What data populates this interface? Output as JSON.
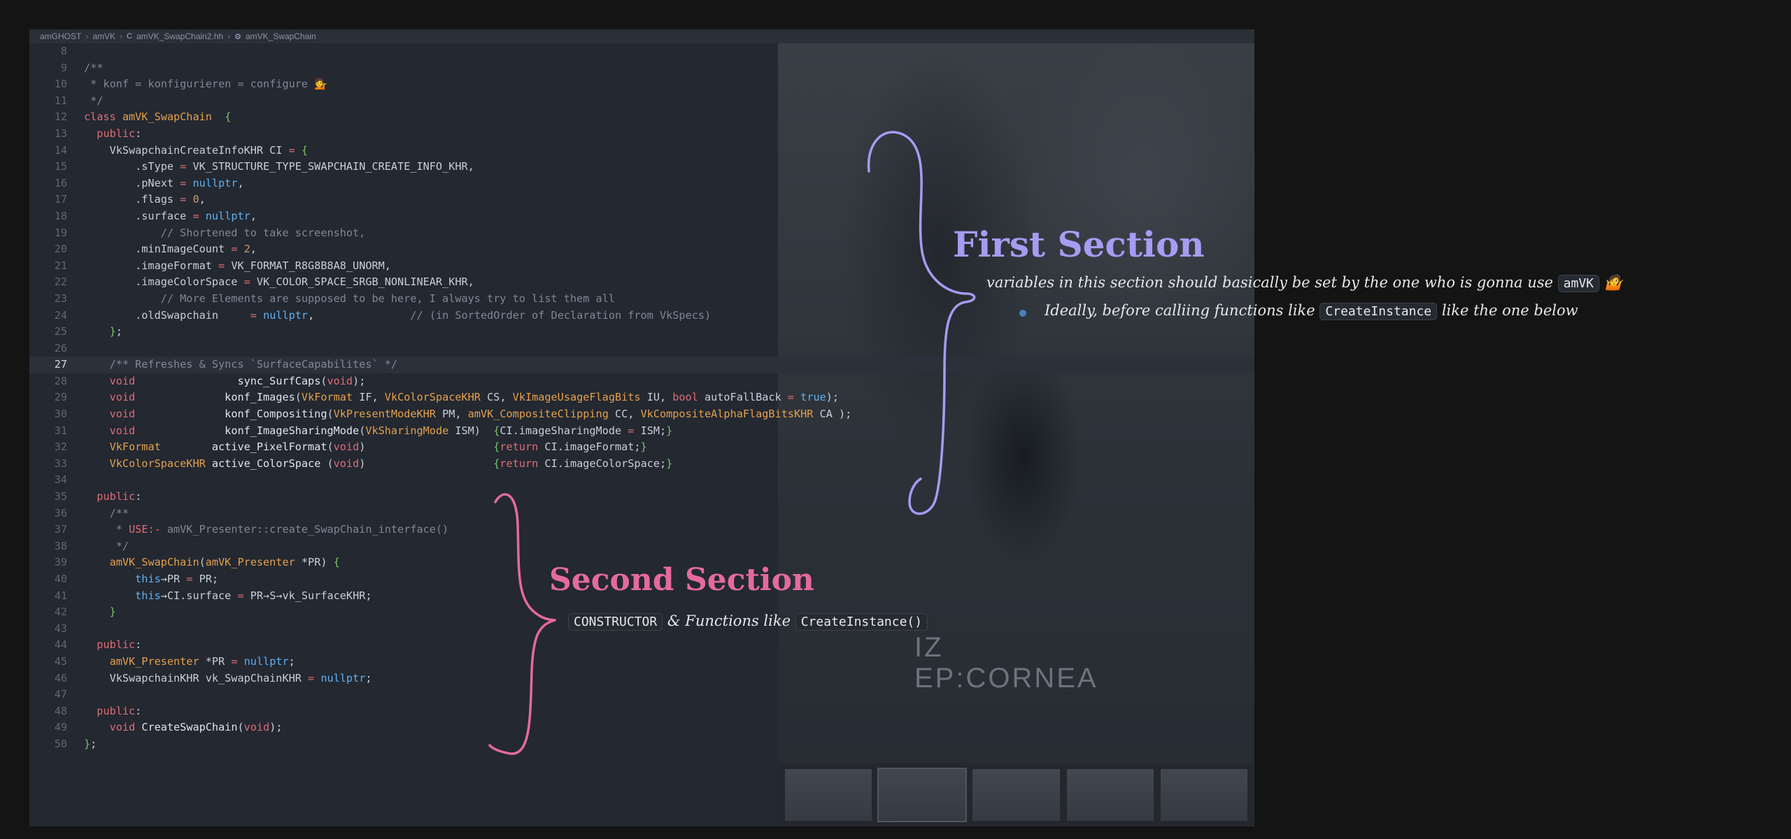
{
  "breadcrumb": {
    "items": [
      "amGHOST",
      "amVK",
      "amVK_SwapChain2.hh",
      "amVK_SwapChain"
    ]
  },
  "editor": {
    "current_line": "27",
    "lines": [
      {
        "n": "8",
        "t": ""
      },
      {
        "n": "9",
        "t": "/**"
      },
      {
        "n": "10",
        "t": " * konf = konfigurieren = configure 💁"
      },
      {
        "n": "11",
        "t": " */"
      },
      {
        "n": "12",
        "t": "class amVK_SwapChain  {"
      },
      {
        "n": "13",
        "t": "  public:"
      },
      {
        "n": "14",
        "t": "    VkSwapchainCreateInfoKHR CI = {"
      },
      {
        "n": "15",
        "t": "        .sType = VK_STRUCTURE_TYPE_SWAPCHAIN_CREATE_INFO_KHR,"
      },
      {
        "n": "16",
        "t": "        .pNext = nullptr,"
      },
      {
        "n": "17",
        "t": "        .flags = 0,"
      },
      {
        "n": "18",
        "t": "        .surface = nullptr,"
      },
      {
        "n": "19",
        "t": "            // Shortened to take screenshot,"
      },
      {
        "n": "20",
        "t": "        .minImageCount = 2,"
      },
      {
        "n": "21",
        "t": "        .imageFormat = VK_FORMAT_R8G8B8A8_UNORM,"
      },
      {
        "n": "22",
        "t": "        .imageColorSpace = VK_COLOR_SPACE_SRGB_NONLINEAR_KHR,"
      },
      {
        "n": "23",
        "t": "            // More Elements are supposed to be here, I always try to list them all"
      },
      {
        "n": "24",
        "t": "        .oldSwapchain     = nullptr,               // (in SortedOrder of Declaration from VkSpecs)"
      },
      {
        "n": "25",
        "t": "    };"
      },
      {
        "n": "26",
        "t": ""
      },
      {
        "n": "27",
        "t": "    /** Refreshes & Syncs `SurfaceCapabilites` */"
      },
      {
        "n": "28",
        "t": "    void                sync_SurfCaps(void);"
      },
      {
        "n": "29",
        "t": "    void              konf_Images(VkFormat IF, VkColorSpaceKHR CS, VkImageUsageFlagBits IU, bool autoFallBack = true);"
      },
      {
        "n": "30",
        "t": "    void              konf_Compositing(VkPresentModeKHR PM, amVK_CompositeClipping CC, VkCompositeAlphaFlagBitsKHR CA );"
      },
      {
        "n": "31",
        "t": "    void              konf_ImageSharingMode(VkSharingMode ISM)  {CI.imageSharingMode = ISM;}"
      },
      {
        "n": "32",
        "t": "    VkFormat        active_PixelFormat(void)                    {return CI.imageFormat;}"
      },
      {
        "n": "33",
        "t": "    VkColorSpaceKHR active_ColorSpace (void)                    {return CI.imageColorSpace;}"
      },
      {
        "n": "34",
        "t": ""
      },
      {
        "n": "35",
        "t": "  public:"
      },
      {
        "n": "36",
        "t": "    /**"
      },
      {
        "n": "37",
        "t": "     * USE:- amVK_Presenter::create_SwapChain_interface()"
      },
      {
        "n": "38",
        "t": "     */"
      },
      {
        "n": "39",
        "t": "    amVK_SwapChain(amVK_Presenter *PR) {"
      },
      {
        "n": "40",
        "t": "        this→PR = PR;"
      },
      {
        "n": "41",
        "t": "        this→CI.surface = PR→S→vk_SurfaceKHR;"
      },
      {
        "n": "42",
        "t": "    }"
      },
      {
        "n": "43",
        "t": ""
      },
      {
        "n": "44",
        "t": "  public:"
      },
      {
        "n": "45",
        "t": "    amVK_Presenter *PR = nullptr;"
      },
      {
        "n": "46",
        "t": "    VkSwapchainKHR vk_SwapChainKHR = nullptr;"
      },
      {
        "n": "47",
        "t": ""
      },
      {
        "n": "48",
        "t": "  public:"
      },
      {
        "n": "49",
        "t": "    void CreateSwapChain(void);"
      },
      {
        "n": "50",
        "t": "};"
      }
    ]
  },
  "background": {
    "poster_line1": "IZ",
    "poster_line2": "EP:CORNEA"
  },
  "annotations": {
    "first": {
      "title": "First Section",
      "line1_text": "variables in this section should basically be set by the one who is gonna use",
      "line1_code": "amVK",
      "line1_emoji": "🤷",
      "bullet_pre": "Ideally, before calliing functions like",
      "bullet_code": "CreateInstance",
      "bullet_post": "like the one below",
      "color": "#a79bf2"
    },
    "second": {
      "title": "Second Section",
      "code1": "CONSTRUCTOR",
      "text": "& Functions like",
      "code2": "CreateInstance()",
      "color": "#e46a9e"
    }
  }
}
